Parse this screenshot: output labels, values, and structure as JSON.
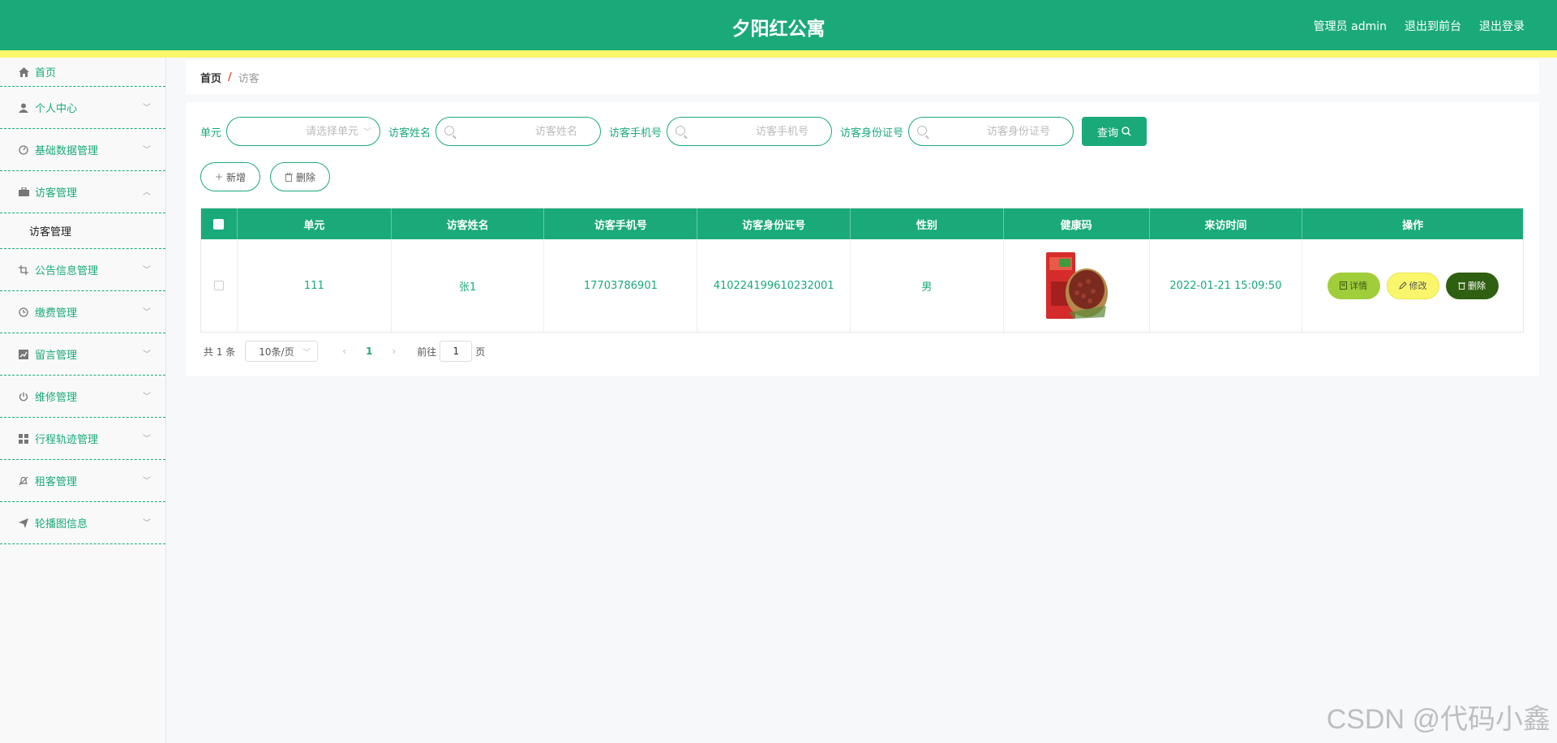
{
  "header": {
    "title": "夕阳红公寓",
    "admin_label": "管理员 admin",
    "frontend_link": "退出到前台",
    "logout_link": "退出登录",
    "color_primary": "#1aaa79",
    "color_stripe": "#fbf56a"
  },
  "sidebar": {
    "items": [
      {
        "label": "首页",
        "icon": "home-icon"
      },
      {
        "label": "个人中心",
        "icon": "user-icon"
      },
      {
        "label": "基础数据管理",
        "icon": "gauge-icon"
      },
      {
        "label": "访客管理",
        "icon": "briefcase-icon"
      },
      {
        "label": "公告信息管理",
        "icon": "crop-icon"
      },
      {
        "label": "缴费管理",
        "icon": "clock-icon"
      },
      {
        "label": "留言管理",
        "icon": "chart-icon"
      },
      {
        "label": "维修管理",
        "icon": "power-icon"
      },
      {
        "label": "行程轨迹管理",
        "icon": "grid-icon"
      },
      {
        "label": "租客管理",
        "icon": "bell-off-icon"
      },
      {
        "label": "轮播图信息",
        "icon": "send-icon"
      }
    ],
    "submenu": {
      "label": "访客管理"
    }
  },
  "breadcrumb": {
    "home": "首页",
    "separator": "/",
    "current": "访客"
  },
  "search": {
    "unit_label": "单元",
    "unit_placeholder": "请选择单元",
    "name_label": "访客姓名",
    "name_placeholder": "访客姓名",
    "phone_label": "访客手机号",
    "phone_placeholder": "访客手机号",
    "idcard_label": "访客身份证号",
    "idcard_placeholder": "访客身份证号",
    "query_button": "查询"
  },
  "actions": {
    "add_button": "新增",
    "delete_button": "删除"
  },
  "table": {
    "columns": [
      "单元",
      "访客姓名",
      "访客手机号",
      "访客身份证号",
      "性别",
      "健康码",
      "来访时间",
      "操作"
    ],
    "rows": [
      {
        "unit": "111",
        "name": "张1",
        "phone": "17703786901",
        "idcard": "410224199610232001",
        "gender": "男",
        "visit_time": "2022-01-21 15:09:50",
        "op_detail": "详情",
        "op_edit": "修改",
        "op_delete": "删除"
      }
    ]
  },
  "pagination": {
    "total": "共 1 条",
    "page_size": "10条/页",
    "current_page": "1",
    "goto_label": "前往",
    "goto_value": "1",
    "page_suffix": "页"
  },
  "watermark": "CSDN @代码小鑫"
}
